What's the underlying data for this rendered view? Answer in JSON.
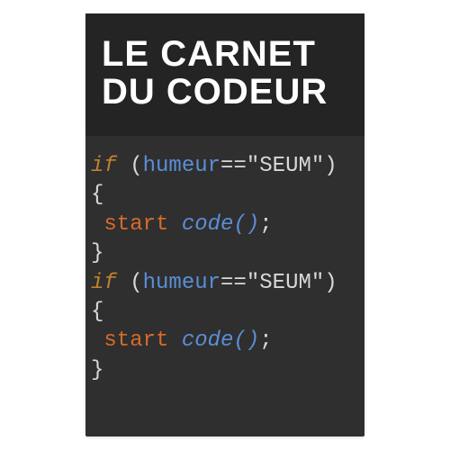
{
  "title": {
    "line1": "LE CARNET",
    "line2": "DU CODEUR"
  },
  "code": {
    "blocks": [
      {
        "if": "if",
        "open_paren": " (",
        "identifier": "humeur",
        "operator": "==",
        "string": "\"SEUM\"",
        "close_paren": ")",
        "open_brace": "{",
        "indent": " ",
        "start": "start",
        "space": " ",
        "fn": "code()",
        "semi": ";",
        "close_brace": "}"
      },
      {
        "if": "if",
        "open_paren": " (",
        "identifier": "humeur",
        "operator": "==",
        "string": "\"SEUM\"",
        "close_paren": ")",
        "open_brace": "{",
        "indent": " ",
        "start": "start",
        "space": " ",
        "fn": "code()",
        "semi": ";",
        "close_brace": "}"
      }
    ]
  }
}
